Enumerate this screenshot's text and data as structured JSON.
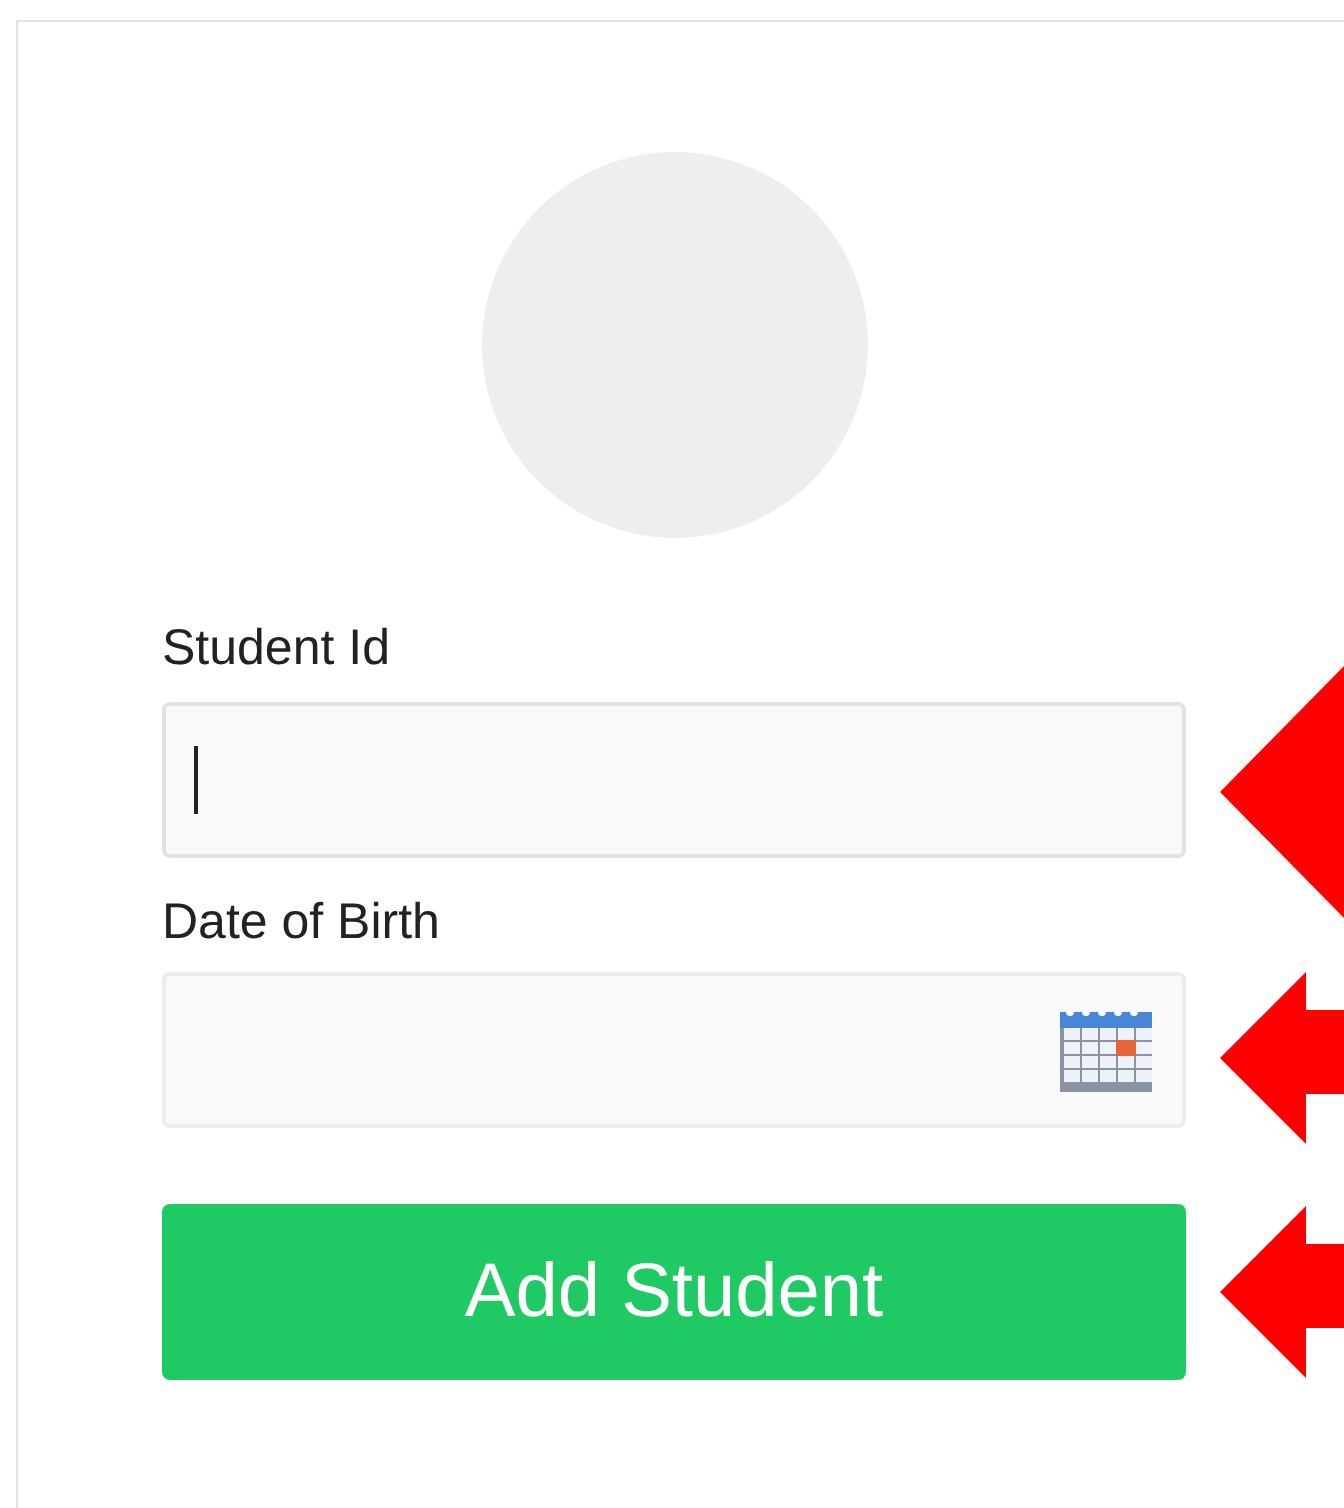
{
  "avatar": {
    "kind": "placeholder"
  },
  "fields": [
    {
      "label": "Student Id",
      "kind": "text",
      "focused": true
    },
    {
      "label": "Date of Birth",
      "kind": "date",
      "focused": false
    }
  ],
  "submit_button": {
    "label": "Add Student"
  },
  "annotations": [
    {
      "kind": "triangle"
    },
    {
      "kind": "arrow"
    },
    {
      "kind": "arrow"
    }
  ]
}
